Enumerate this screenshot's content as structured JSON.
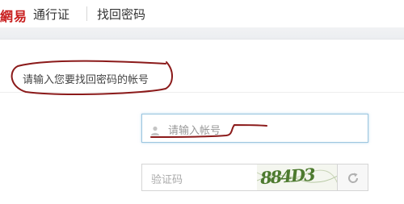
{
  "header": {
    "logo_text": "網易",
    "product_name": "通行证",
    "page_heading": "找回密码"
  },
  "step": {
    "instruction": "请输入您要找回密码的帐号"
  },
  "form": {
    "account_placeholder": "请输入帐号",
    "captcha_placeholder": "验证码",
    "captcha_image_text": "884D3",
    "user_icon": "user-icon",
    "refresh_icon": "refresh-icon"
  },
  "colors": {
    "logo_red": "#c81e1e",
    "annotation_ink": "#8b1a1a",
    "focus_border": "#9cc6df"
  }
}
